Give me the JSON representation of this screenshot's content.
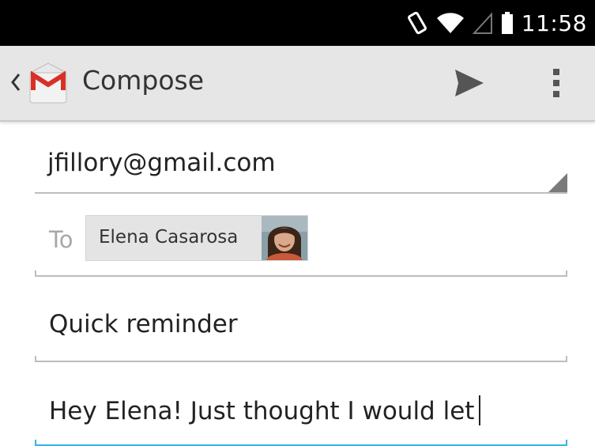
{
  "status_bar": {
    "time": "11:58",
    "icons": [
      "screen-rotation-icon",
      "wifi-icon",
      "cell-signal-icon",
      "battery-icon"
    ]
  },
  "action_bar": {
    "title": "Compose",
    "app_icon": "gmail-icon",
    "actions": [
      "send-icon",
      "overflow-menu-icon"
    ]
  },
  "compose": {
    "from": "jfillory@gmail.com",
    "to_label": "To",
    "recipients": [
      {
        "name": "Elena Casarosa",
        "icon": "contact-avatar"
      }
    ],
    "subject": "Quick reminder",
    "body": "Hey Elena! Just thought I would let"
  },
  "colors": {
    "status_bar_bg": "#000000",
    "action_bar_bg": "#e6e6e6",
    "focus_accent": "#33b5e5",
    "field_line": "#bdbdbd",
    "gmail_red": "#d93025"
  }
}
